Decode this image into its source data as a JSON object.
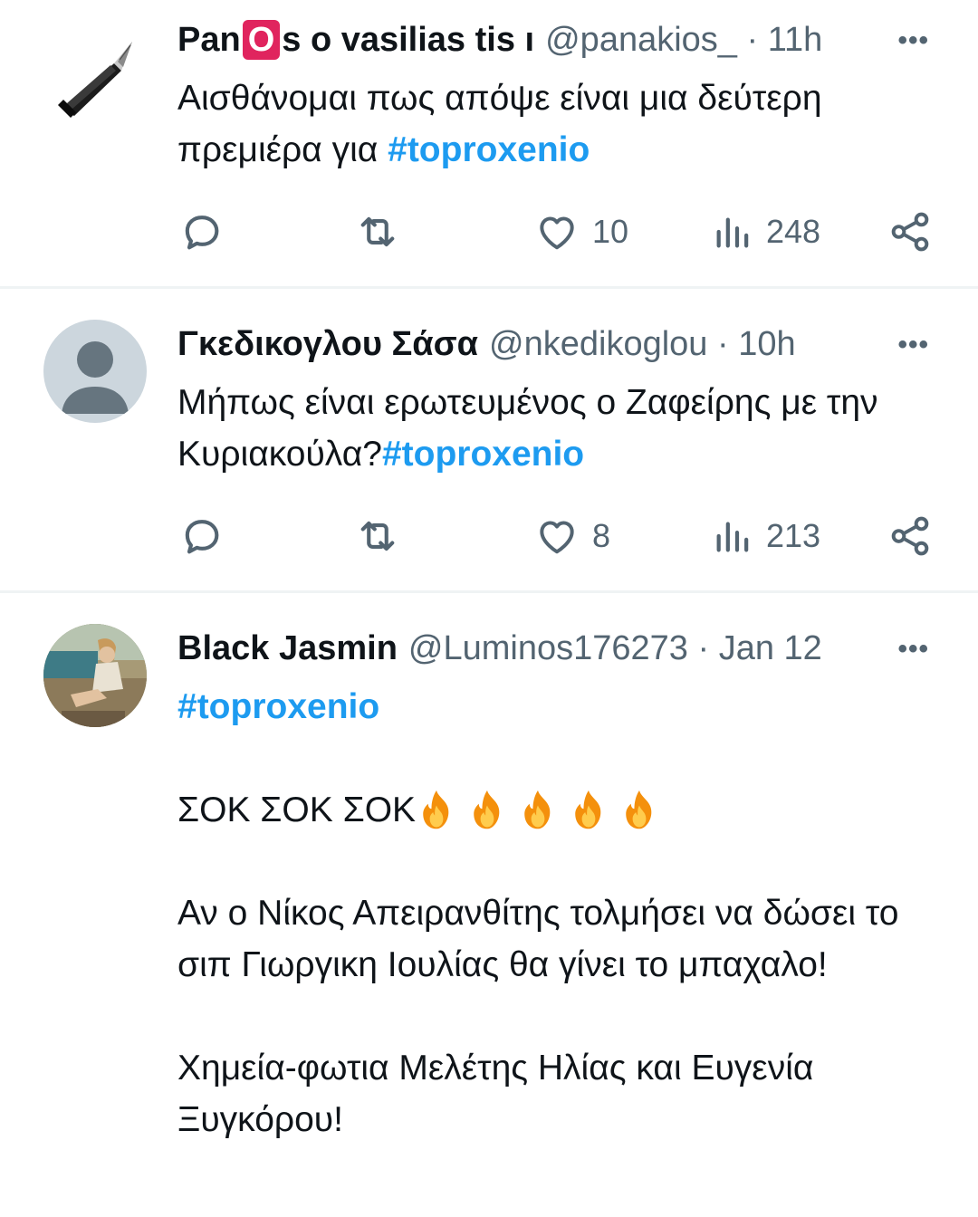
{
  "tweets": [
    {
      "name_prefix": "Pan",
      "name_badge": "O",
      "name_suffix": "s o vasilias tis",
      "name_truncation": "ı",
      "handle": "@panakios_",
      "time": "· 11h",
      "more": "•••",
      "text_plain": "Αισθάνομαι πως απόψε είναι μια δεύτερη πρεμιέρα για ",
      "hashtag": "#toproxenio",
      "replies": "",
      "retweets": "",
      "likes": "10",
      "views": "248",
      "avatar_icon": "fountain-pen-avatar"
    },
    {
      "name": "Γκεδικογλου Σάσα",
      "handle": "@nkedikoglou",
      "time": "· 10h",
      "more": "•••",
      "text_plain": "Μήπως είναι ερωτευμένος ο  Ζαφείρης με την Κυριακούλα?",
      "hashtag": "#toproxenio",
      "replies": "",
      "retweets": "",
      "likes": "8",
      "views": "213",
      "avatar_icon": "default-user-avatar"
    },
    {
      "name": "Black Jasmin",
      "handle": "@Luminos176273",
      "time": "· Jan 12",
      "more": "•••",
      "hashtag": "#toproxenio",
      "line_shock": "ΣΟΚ ΣΟΚ ΣΟΚ",
      "flame_count": 5,
      "para1": "Αν ο Νίκος Απειρανθίτης τολμήσει να δώσει το σιπ Γιωργικη Ιουλίας θα γίνει το μπαχαλο!",
      "para2": "Χημεία-φωτια Μελέτης Ηλίας και Ευγενία Ξυγκόρου!",
      "avatar_icon": "photo-avatar"
    }
  ],
  "colors": {
    "hashtag": "#1d9bf0",
    "secondary": "#536471",
    "divider": "#eff3f4",
    "badge": "#e0245e"
  }
}
